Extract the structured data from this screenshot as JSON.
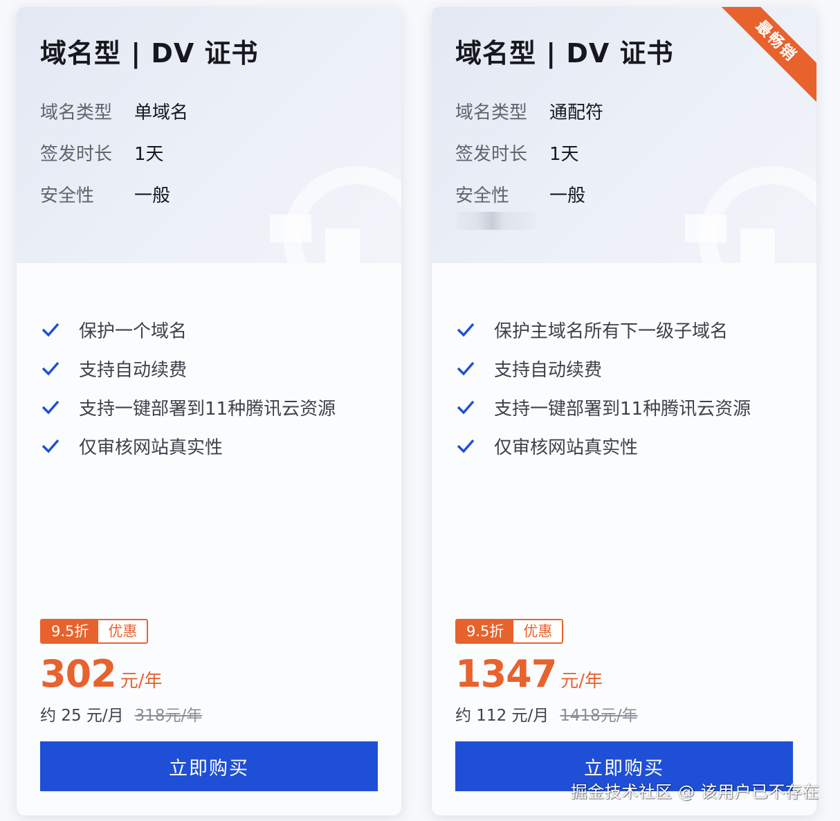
{
  "cards": [
    {
      "title": "域名型 | DV 证书",
      "specs": [
        {
          "key": "域名类型",
          "value": "单域名"
        },
        {
          "key": "签发时长",
          "value": "1天"
        },
        {
          "key": "安全性",
          "value": "一般"
        }
      ],
      "features": [
        "保护一个域名",
        "支持自动续费",
        "支持一键部署到11种腾讯云资源",
        "仅审核网站真实性"
      ],
      "discount_label": "9.5折",
      "promo_label": "优惠",
      "price": "302",
      "price_unit": "元/年",
      "monthly": "约 25 元/月",
      "original_price": "318元/年",
      "buy_label": "立即购买"
    },
    {
      "title": "域名型 | DV 证书",
      "ribbon": "最畅销",
      "specs": [
        {
          "key": "域名类型",
          "value": "通配符"
        },
        {
          "key": "签发时长",
          "value": "1天"
        },
        {
          "key": "安全性",
          "value": "一般"
        }
      ],
      "features": [
        "保护主域名所有下一级子域名",
        "支持自动续费",
        "支持一键部署到11种腾讯云资源",
        "仅审核网站真实性"
      ],
      "discount_label": "9.5折",
      "promo_label": "优惠",
      "price": "1347",
      "price_unit": "元/年",
      "monthly": "约 112 元/月",
      "original_price": "1418元/年",
      "buy_label": "立即购买"
    }
  ],
  "watermark": "掘金技术社区 @ 该用户已不存在",
  "colors": {
    "accent": "#e8622e",
    "button": "#1f4fd6",
    "check": "#1f4fd6"
  }
}
